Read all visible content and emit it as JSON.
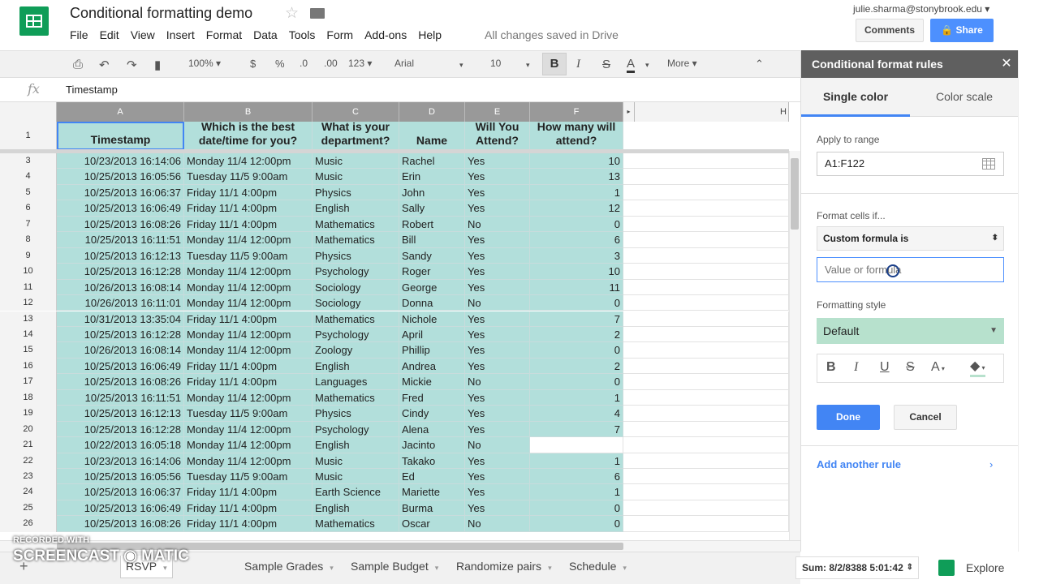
{
  "header": {
    "doc_title": "Conditional formatting demo",
    "saved_status": "All changes saved in Drive",
    "user_email": "julie.sharma@stonybrook.edu",
    "comments_label": "Comments",
    "share_label": "Share"
  },
  "menu": [
    "File",
    "Edit",
    "View",
    "Insert",
    "Format",
    "Data",
    "Tools",
    "Form",
    "Add-ons",
    "Help"
  ],
  "toolbar": {
    "zoom": "100%",
    "currency": "$",
    "percent": "%",
    "dec_less": ".0",
    "dec_more": ".00",
    "number_format": "123",
    "font": "Arial",
    "font_size": "10",
    "bold": "B",
    "italic": "I",
    "strike": "S",
    "text_color": "A",
    "more": "More"
  },
  "formula_bar": {
    "fx": "fx",
    "value": "Timestamp"
  },
  "columns": [
    "A",
    "B",
    "C",
    "D",
    "E",
    "F",
    "H"
  ],
  "header_row": {
    "row": "1",
    "cells": [
      "Timestamp",
      "Which is the best date/time for you?",
      "What is your department?",
      "Name",
      "Will You Attend?",
      "How many will attend?"
    ]
  },
  "rows": [
    {
      "n": "3",
      "c": [
        "10/23/2013 16:14:06",
        "Monday 11/4 12:00pm",
        "Music",
        "Rachel",
        "Yes",
        "10"
      ]
    },
    {
      "n": "4",
      "c": [
        "10/25/2013 16:05:56",
        "Tuesday 11/5 9:00am",
        "Music",
        "Erin",
        "Yes",
        "13"
      ]
    },
    {
      "n": "5",
      "c": [
        "10/25/2013 16:06:37",
        "Friday 11/1 4:00pm",
        "Physics",
        "John",
        "Yes",
        "1"
      ]
    },
    {
      "n": "6",
      "c": [
        "10/25/2013 16:06:49",
        "Friday 11/1 4:00pm",
        "English",
        "Sally",
        "Yes",
        "12"
      ]
    },
    {
      "n": "7",
      "c": [
        "10/25/2013 16:08:26",
        "Friday 11/1 4:00pm",
        "Mathematics",
        "Robert",
        "No",
        "0"
      ]
    },
    {
      "n": "8",
      "c": [
        "10/25/2013 16:11:51",
        "Monday 11/4 12:00pm",
        "Mathematics",
        "Bill",
        "Yes",
        "6"
      ]
    },
    {
      "n": "9",
      "c": [
        "10/25/2013 16:12:13",
        "Tuesday 11/5 9:00am",
        "Physics",
        "Sandy",
        "Yes",
        "3"
      ]
    },
    {
      "n": "10",
      "c": [
        "10/25/2013 16:12:28",
        "Monday 11/4 12:00pm",
        "Psychology",
        "Roger",
        "Yes",
        "10"
      ]
    },
    {
      "n": "11",
      "c": [
        "10/26/2013 16:08:14",
        "Monday 11/4 12:00pm",
        "Sociology",
        "George",
        "Yes",
        "11"
      ]
    },
    {
      "n": "12",
      "c": [
        "10/26/2013 16:11:01",
        "Monday 11/4 12:00pm",
        "Sociology",
        "Donna",
        "No",
        "0"
      ]
    },
    {
      "n": "13",
      "c": [
        "10/31/2013 13:35:04",
        "Friday 11/1 4:00pm",
        "Mathematics",
        "Nichole",
        "Yes",
        "7"
      ]
    },
    {
      "n": "14",
      "c": [
        "10/25/2013 16:12:28",
        "Monday 11/4 12:00pm",
        "Psychology",
        "April",
        "Yes",
        "2"
      ]
    },
    {
      "n": "15",
      "c": [
        "10/26/2013 16:08:14",
        "Monday 11/4 12:00pm",
        "Zoology",
        "Phillip",
        "Yes",
        "0"
      ]
    },
    {
      "n": "16",
      "c": [
        "10/25/2013 16:06:49",
        "Friday 11/1 4:00pm",
        "English",
        "Andrea",
        "Yes",
        "2"
      ]
    },
    {
      "n": "17",
      "c": [
        "10/25/2013 16:08:26",
        "Friday 11/1 4:00pm",
        "Languages",
        "Mickie",
        "No",
        "0"
      ]
    },
    {
      "n": "18",
      "c": [
        "10/25/2013 16:11:51",
        "Monday 11/4 12:00pm",
        "Mathematics",
        "Fred",
        "Yes",
        "1"
      ]
    },
    {
      "n": "19",
      "c": [
        "10/25/2013 16:12:13",
        "Tuesday 11/5 9:00am",
        "Physics",
        "Cindy",
        "Yes",
        "4"
      ]
    },
    {
      "n": "20",
      "c": [
        "10/25/2013 16:12:28",
        "Monday 11/4 12:00pm",
        "Psychology",
        "Alena",
        "Yes",
        "7"
      ]
    },
    {
      "n": "21",
      "c": [
        "10/22/2013 16:05:18",
        "Monday 11/4 12:00pm",
        "English",
        "Jacinto",
        "No",
        ""
      ]
    },
    {
      "n": "22",
      "c": [
        "10/23/2013 16:14:06",
        "Monday 11/4 12:00pm",
        "Music",
        "Takako",
        "Yes",
        "1"
      ]
    },
    {
      "n": "23",
      "c": [
        "10/25/2013 16:05:56",
        "Tuesday 11/5 9:00am",
        "Music",
        "Ed",
        "Yes",
        "6"
      ]
    },
    {
      "n": "24",
      "c": [
        "10/25/2013 16:06:37",
        "Friday 11/1 4:00pm",
        "Earth Science",
        "Mariette",
        "Yes",
        "1"
      ]
    },
    {
      "n": "25",
      "c": [
        "10/25/2013 16:06:49",
        "Friday 11/1 4:00pm",
        "English",
        "Burma",
        "Yes",
        "0"
      ]
    },
    {
      "n": "26",
      "c": [
        "10/25/2013 16:08:26",
        "Friday 11/1 4:00pm",
        "Mathematics",
        "Oscar",
        "No",
        "0"
      ]
    }
  ],
  "sheet_tabs": [
    "RSVP",
    "Sample Grades",
    "Sample Budget",
    "Randomize pairs",
    "Schedule"
  ],
  "sum": "Sum: 8/2/8388 5:01:42",
  "explore_label": "Explore",
  "panel": {
    "title": "Conditional format rules",
    "tab_single": "Single color",
    "tab_scale": "Color scale",
    "apply_label": "Apply to range",
    "range": "A1:F122",
    "format_if_label": "Format cells if...",
    "condition": "Custom formula is",
    "formula_placeholder": "Value or formula",
    "style_label": "Formatting style",
    "style_value": "Default",
    "done": "Done",
    "cancel": "Cancel",
    "add_rule": "Add another rule"
  },
  "watermark": {
    "line1": "RECORDED WITH",
    "line2": "SCREENCAST",
    "line3": "MATIC"
  },
  "colors": {
    "highlight": "#b2dfdb",
    "accent": "#4285f4",
    "panel_header": "#5f5f5f",
    "style_preview": "#b7e1cd",
    "sheets_green": "#0f9d58"
  }
}
